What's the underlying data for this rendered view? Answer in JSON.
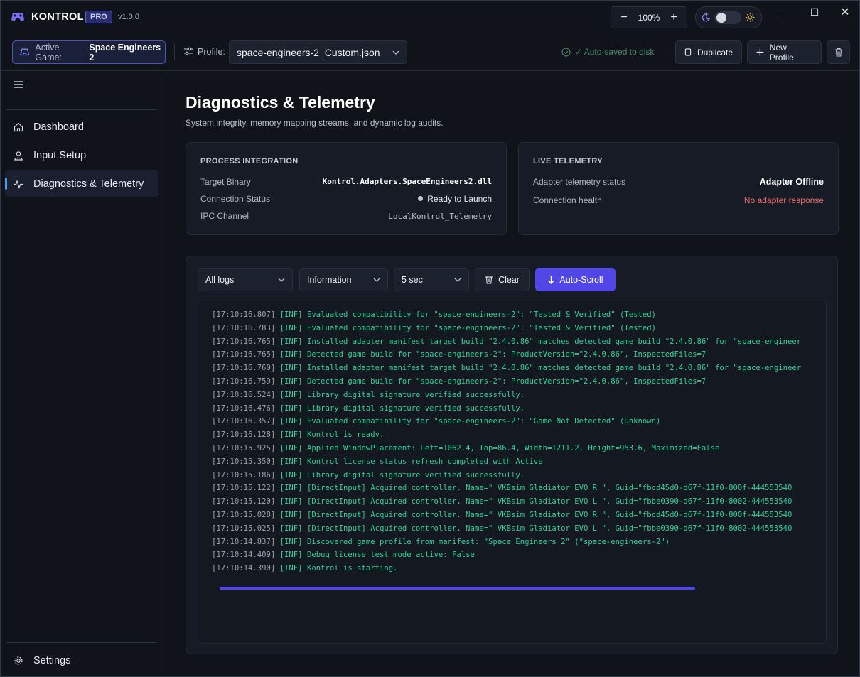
{
  "app": {
    "name": "KONTROL",
    "badge": "PRO",
    "version": "v1.0.0"
  },
  "zoom": {
    "level": "100%",
    "minus": "−",
    "plus": "+"
  },
  "theme": {
    "mode": "dark",
    "moon_icon": "moon-icon",
    "sun_icon": "sun-icon"
  },
  "window_controls": {
    "minimize": "—",
    "maximize": "☐",
    "close": "✕"
  },
  "toolbar": {
    "active_game_label": "Active Game:",
    "active_game_value": "Space Engineers 2",
    "profile_label": "Profile:",
    "profile_value": "space-engineers-2_Custom.json",
    "autosaved": "✓ Auto-saved to disk",
    "duplicate": "Duplicate",
    "new_profile": "New Profile"
  },
  "sidebar": {
    "items": [
      {
        "label": "Dashboard",
        "icon": "home-icon"
      },
      {
        "label": "Input Setup",
        "icon": "user-icon"
      },
      {
        "label": "Diagnostics & Telemetry",
        "icon": "pulse-icon",
        "active": true
      }
    ],
    "settings": "Settings"
  },
  "page": {
    "title": "Diagnostics & Telemetry",
    "subtitle": "System integrity, memory mapping streams, and dynamic log audits."
  },
  "process": {
    "title": "PROCESS INTEGRATION",
    "rows": [
      {
        "label": "Target Binary",
        "value": "Kontrol.Adapters.SpaceEngineers2.dll"
      },
      {
        "label": "Connection Status",
        "value": "Ready to Launch"
      },
      {
        "label": "IPC Channel",
        "value": "LocalKontrol_Telemetry"
      }
    ]
  },
  "telemetry": {
    "title": "LIVE TELEMETRY",
    "rows": [
      {
        "label": "Adapter telemetry status",
        "value": "Adapter Offline"
      },
      {
        "label": "Connection health",
        "value": "No adapter response"
      }
    ],
    "error_color": "#f06a6a"
  },
  "logs": {
    "filter": "All logs",
    "level": "Information",
    "interval": "5 sec",
    "clear": "Clear",
    "autoscroll": "Auto-Scroll",
    "accent": "#5147e6",
    "lines": [
      {
        "ts": "[17:10:16.807]",
        "msg": " [INF] Evaluated compatibility for \"space-engineers-2\": \"Tested & Verified\" (Tested)"
      },
      {
        "ts": "[17:10:16.783]",
        "msg": " [INF] Evaluated compatibility for \"space-engineers-2\": \"Tested & Verified\" (Tested)"
      },
      {
        "ts": "[17:10:16.765]",
        "msg": " [INF] Installed adapter manifest target build \"2.4.0.86\" matches detected game build \"2.4.0.86\" for \"space-engineer"
      },
      {
        "ts": "[17:10:16.765]",
        "msg": " [INF] Detected game build for \"space-engineers-2\": ProductVersion=\"2.4.0.86\", InspectedFiles=7"
      },
      {
        "ts": "[17:10:16.760]",
        "msg": " [INF] Installed adapter manifest target build \"2.4.0.86\" matches detected game build \"2.4.0.86\" for \"space-engineer"
      },
      {
        "ts": "[17:10:16.759]",
        "msg": " [INF] Detected game build for \"space-engineers-2\": ProductVersion=\"2.4.0.86\", InspectedFiles=7"
      },
      {
        "ts": "[17:10:16.524]",
        "msg": " [INF] Library digital signature verified successfully."
      },
      {
        "ts": "[17:10:16.476]",
        "msg": " [INF] Library digital signature verified successfully."
      },
      {
        "ts": "[17:10:16.357]",
        "msg": " [INF] Evaluated compatibility for \"space-engineers-2\": \"Game Not Detected\" (Unknown)"
      },
      {
        "ts": "[17:10:16.128]",
        "msg": " [INF] Kontrol is ready."
      },
      {
        "ts": "[17:10:15.925]",
        "msg": " [INF] Applied WindowPlacement: Left=1062.4, Top=86.4, Width=1211.2, Height=953.6, Maximized=False"
      },
      {
        "ts": "[17:10:15.350]",
        "msg": " [INF] Kontrol license status refresh completed with Active"
      },
      {
        "ts": "[17:10:15.186]",
        "msg": " [INF] Library digital signature verified successfully."
      },
      {
        "ts": "[17:10:15.122]",
        "msg": " [INF] [DirectInput] Acquired controller. Name=\" VKBsim Gladiator EVO R  \", Guid=\"fbcd45d0-d67f-11f0-800f-444553540"
      },
      {
        "ts": "[17:10:15.120]",
        "msg": " [INF] [DirectInput] Acquired controller. Name=\" VKBsim Gladiator EVO L  \", Guid=\"fbbe0390-d67f-11f0-8002-444553540"
      },
      {
        "ts": "[17:10:15.028]",
        "msg": " [INF] [DirectInput] Acquired controller. Name=\" VKBsim Gladiator EVO R  \", Guid=\"fbcd45d0-d67f-11f0-800f-444553540"
      },
      {
        "ts": "[17:10:15.025]",
        "msg": " [INF] [DirectInput] Acquired controller. Name=\" VKBsim Gladiator EVO L  \", Guid=\"fbbe0390-d67f-11f0-8002-444553540"
      },
      {
        "ts": "[17:10:14.837]",
        "msg": " [INF] Discovered game profile from manifest: \"Space Engineers 2\" (\"space-engineers-2\")"
      },
      {
        "ts": "[17:10:14.409]",
        "msg": " [INF] Debug license test mode active: False"
      },
      {
        "ts": "[17:10:14.390]",
        "msg": " [INF] Kontrol is starting."
      }
    ]
  }
}
